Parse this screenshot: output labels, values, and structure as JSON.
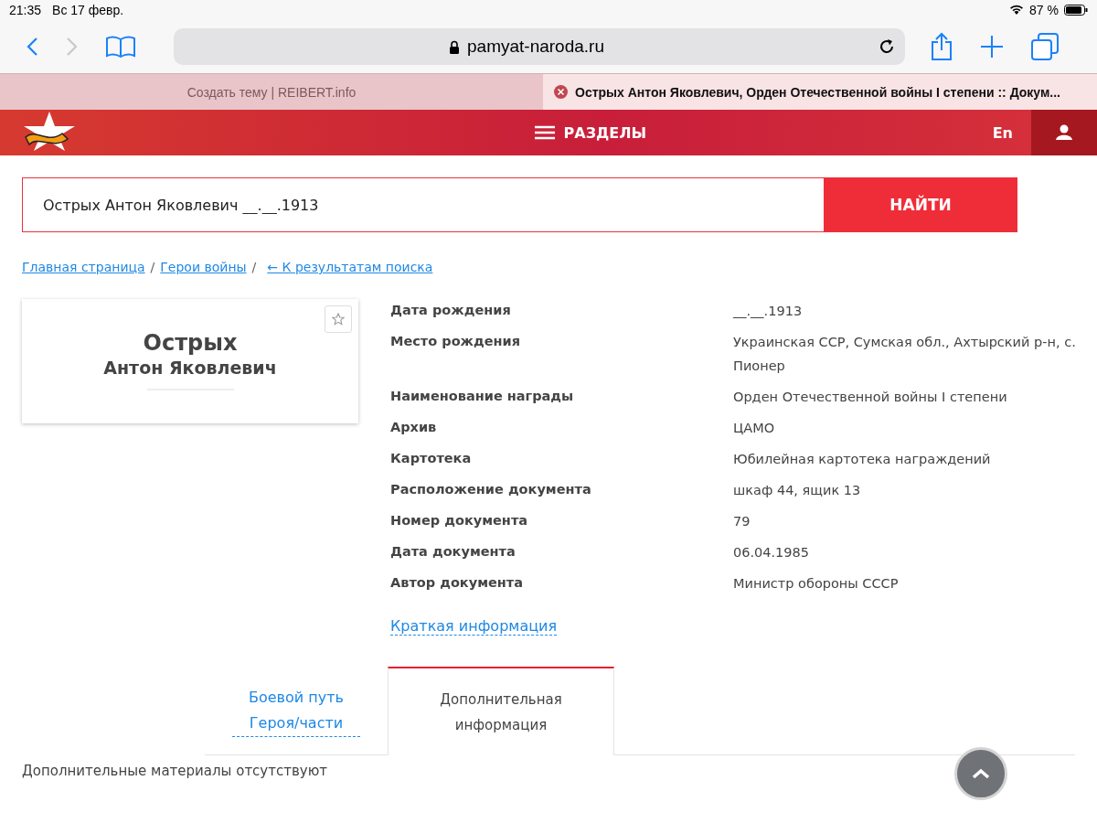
{
  "status_bar": {
    "time": "21:35",
    "date": "Вс 17 февр.",
    "battery": "87 %"
  },
  "browser": {
    "url": "pamyat-naroda.ru",
    "tabs": [
      {
        "title": "Создать тему | REIBERT.info",
        "selected": false
      },
      {
        "title": "Острых Антон Яковлевич, Орден Отечественной войны I степени :: Докум...",
        "selected": true
      }
    ]
  },
  "header": {
    "menu": "РАЗДЕЛЫ",
    "language": "En"
  },
  "search": {
    "value": "Острых Антон Яковлевич __.__.1913",
    "button": "НАЙТИ"
  },
  "breadcrumbs": [
    {
      "label": "Главная страница",
      "kind": "link",
      "separator": "/"
    },
    {
      "label": "Герои войны",
      "kind": "link",
      "separator": "/"
    },
    {
      "label": "← К результатам поиска",
      "kind": "back"
    }
  ],
  "person": {
    "surname": "Острых",
    "name": "Антон Яковлевич"
  },
  "details": [
    {
      "label": "Дата рождения",
      "value": "__.__.1913"
    },
    {
      "label": "Место рождения",
      "value": "Украинская ССР, Сумская обл., Ахтырский р-н, с. Пионер"
    },
    {
      "label": "Наименование награды",
      "value": "Орден Отечественной войны I степени"
    },
    {
      "label": "Архив",
      "value": "ЦАМО"
    },
    {
      "label": "Картотека",
      "value": "Юбилейная картотека награждений"
    },
    {
      "label": "Расположение документа",
      "value": "шкаф 44, ящик 13"
    },
    {
      "label": "Номер документа",
      "value": "79"
    },
    {
      "label": "Дата документа",
      "value": "06.04.1985"
    },
    {
      "label": "Автор документа",
      "value": "Министр обороны СССР"
    }
  ],
  "short_info_link": "Краткая информация",
  "tabs": [
    {
      "label": "Боевой путь Героя/части",
      "selected": false
    },
    {
      "label": "Дополнительная информация",
      "selected": true
    }
  ],
  "tab_content": "Дополнительные материалы отсутствуют"
}
